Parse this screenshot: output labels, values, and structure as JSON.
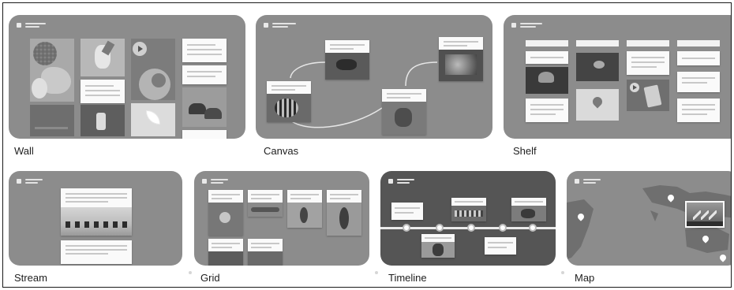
{
  "layouts": [
    {
      "label": "Wall"
    },
    {
      "label": "Canvas"
    },
    {
      "label": "Shelf"
    },
    {
      "label": "Stream"
    },
    {
      "label": "Grid"
    },
    {
      "label": "Timeline"
    },
    {
      "label": "Map"
    }
  ],
  "colors": {
    "card_bg": "#8c8c8c",
    "card_dark_bg": "#555555",
    "post_bg": "#fafafa"
  },
  "icons": [
    "padlet-logo-icon",
    "play-icon",
    "leaf-icon",
    "map-pin-icon"
  ]
}
